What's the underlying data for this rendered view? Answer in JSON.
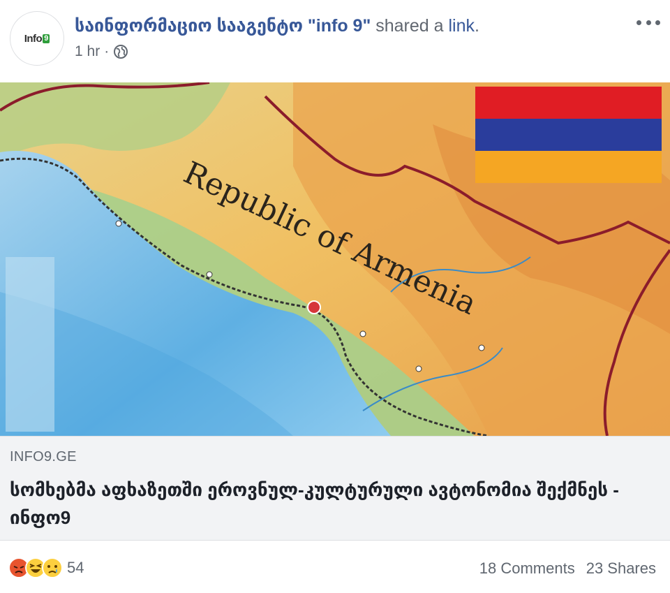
{
  "post": {
    "avatar_text": "Info",
    "avatar_badge": "9",
    "page_name": "საინფორმაციო სააგენტო \"info 9\"",
    "shared_text": " shared a ",
    "link_word": "link",
    "period": ".",
    "time": "1 hr",
    "separator": "·"
  },
  "link": {
    "image_text": "Republic of Armenia",
    "domain": "INFO9.GE",
    "title": "სომხებმა აფხაზეთში ეროვნულ-კულტურული ავტონომია შექმნეს - ინფო9"
  },
  "footer": {
    "reaction_count": "54",
    "comments": "18 Comments",
    "shares": "23 Shares"
  },
  "icons": [
    "globe-icon",
    "more-icon",
    "angry-reaction-icon",
    "haha-reaction-icon",
    "sad-reaction-icon"
  ],
  "colors": {
    "page_link": "#385898",
    "flag_red": "#e01d24",
    "flag_blue": "#2a3d9c",
    "flag_orange": "#f5a623"
  }
}
